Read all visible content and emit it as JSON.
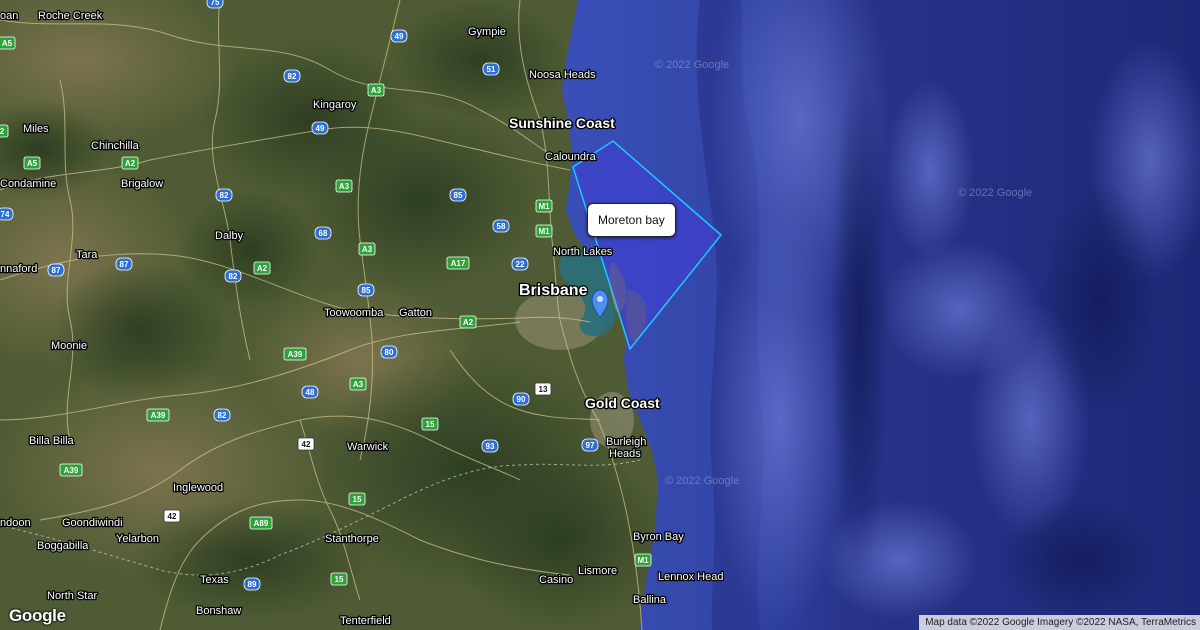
{
  "map": {
    "type": "satellite",
    "region": "South East Queensland",
    "colors": {
      "land": "#4b5a32",
      "land_dark": "#2c3d22",
      "land_light": "#7a7350",
      "shelf": "#2f3d9c",
      "deep_ocean": "#1f2b7d",
      "road": "#d8c98f",
      "polygon_fill": "#3f3fd0",
      "polygon_stroke": "#1ec8ff",
      "marker": "#4e8ff0"
    }
  },
  "places": [
    {
      "name": "Roche Creek"
    },
    {
      "name": "oan"
    },
    {
      "name": "Gympie"
    },
    {
      "name": "Noosa Heads"
    },
    {
      "name": "Sunshine Coast"
    },
    {
      "name": "Kingaroy"
    },
    {
      "name": "Miles"
    },
    {
      "name": "Chinchilla"
    },
    {
      "name": "Caloundra"
    },
    {
      "name": "Condamine"
    },
    {
      "name": "Brigalow"
    },
    {
      "name": "Dalby"
    },
    {
      "name": "Tara"
    },
    {
      "name": "nnaford"
    },
    {
      "name": "North Lakes"
    },
    {
      "name": "Brisbane"
    },
    {
      "name": "Toowoomba"
    },
    {
      "name": "Gatton"
    },
    {
      "name": "Moonie"
    },
    {
      "name": "Gold Coast"
    },
    {
      "name": "Warwick"
    },
    {
      "name": "Billa Billa"
    },
    {
      "name": "Burleigh"
    },
    {
      "name": "Heads"
    },
    {
      "name": "Inglewood"
    },
    {
      "name": "Goondiwindi"
    },
    {
      "name": "ndoon"
    },
    {
      "name": "Boggabilla"
    },
    {
      "name": "Yelarbon"
    },
    {
      "name": "Stanthorpe"
    },
    {
      "name": "Byron Bay"
    },
    {
      "name": "Texas"
    },
    {
      "name": "Lismore"
    },
    {
      "name": "Lennox Head"
    },
    {
      "name": "Casino"
    },
    {
      "name": "North Star"
    },
    {
      "name": "Bonshaw"
    },
    {
      "name": "Tenterfield"
    },
    {
      "name": "Ballina"
    }
  ],
  "road_shields": [
    {
      "label": "75"
    },
    {
      "label": "A5"
    },
    {
      "label": "49"
    },
    {
      "label": "51"
    },
    {
      "label": "82"
    },
    {
      "label": "A3"
    },
    {
      "label": "2"
    },
    {
      "label": "49"
    },
    {
      "label": "A5"
    },
    {
      "label": "A2"
    },
    {
      "label": "A3"
    },
    {
      "label": "85"
    },
    {
      "label": "82"
    },
    {
      "label": "74"
    },
    {
      "label": "58"
    },
    {
      "label": "M1"
    },
    {
      "label": "68"
    },
    {
      "label": "M1"
    },
    {
      "label": "A3"
    },
    {
      "label": "87"
    },
    {
      "label": "87"
    },
    {
      "label": "82"
    },
    {
      "label": "A2"
    },
    {
      "label": "A17"
    },
    {
      "label": "22"
    },
    {
      "label": "85"
    },
    {
      "label": "A2"
    },
    {
      "label": "80"
    },
    {
      "label": "A39"
    },
    {
      "label": "A3"
    },
    {
      "label": "48"
    },
    {
      "label": "13"
    },
    {
      "label": "90"
    },
    {
      "label": "A39"
    },
    {
      "label": "82"
    },
    {
      "label": "15"
    },
    {
      "label": "42"
    },
    {
      "label": "93"
    },
    {
      "label": "97"
    },
    {
      "label": "A39"
    },
    {
      "label": "15"
    },
    {
      "label": "42"
    },
    {
      "label": "A89"
    },
    {
      "label": "M1"
    },
    {
      "label": "89"
    },
    {
      "label": "15"
    }
  ],
  "watermarks": [
    "© 2022 Google",
    "© 2022 Google",
    "© 2022 Google"
  ],
  "polygon": {
    "label": "Moreton bay"
  },
  "marker": {
    "name": "map-pin"
  },
  "attribution": "Map data ©2022 Google Imagery ©2022 NASA, TerraMetrics",
  "logo": "Google"
}
